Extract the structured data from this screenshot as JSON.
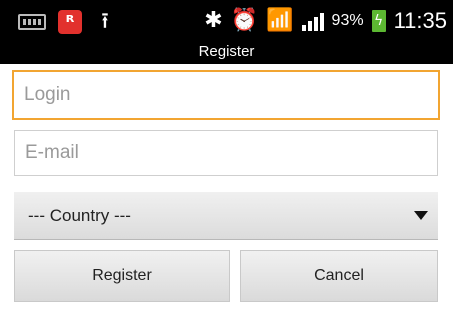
{
  "status_bar": {
    "battery_percent": "93%",
    "time": "11:35",
    "icons": [
      "keyboard-icon",
      "app-icon",
      "upload-icon",
      "bluetooth-icon",
      "alarm-icon",
      "wifi-icon",
      "signal-icon",
      "battery-charging-icon"
    ]
  },
  "header": {
    "title": "Register"
  },
  "form": {
    "login_placeholder": "Login",
    "email_placeholder": "E-mail",
    "country_selected": "--- Country ---",
    "register_label": "Register",
    "cancel_label": "Cancel"
  },
  "colors": {
    "focus_border": "#f2a531",
    "battery": "#5cb832",
    "app_icon": "#e2312d"
  }
}
